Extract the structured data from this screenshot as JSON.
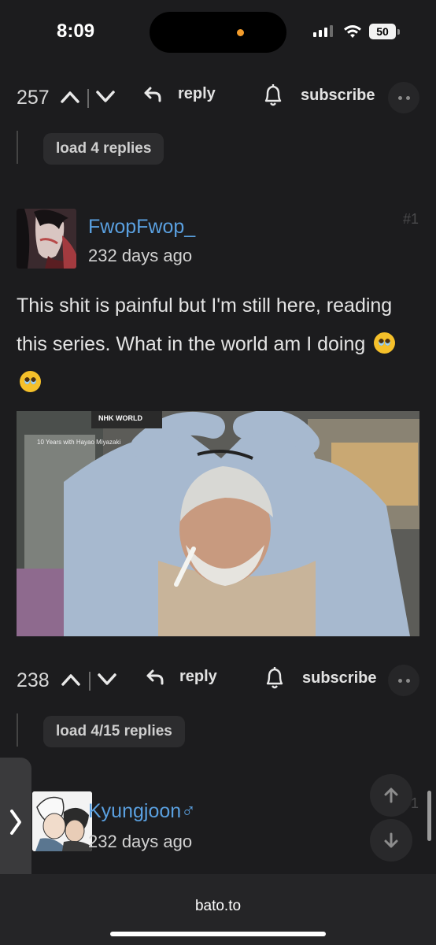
{
  "status_bar": {
    "time": "8:09",
    "battery": "50"
  },
  "comment_1_actions": {
    "votes": "257",
    "reply": "reply",
    "subscribe": "subscribe"
  },
  "replies_1": {
    "label": "load 4 replies"
  },
  "comment_2": {
    "username": "FwopFwop_",
    "ago": "232 days ago",
    "number": "#1",
    "body": "This shit is painful but I'm still here, reading this series. What in the world am I doing",
    "image_caption_brand": "NHK WORLD",
    "image_caption_show": "10 Years with Hayao Miyazaki",
    "votes": "238",
    "reply": "reply",
    "subscribe": "subscribe"
  },
  "replies_2": {
    "label": "load 4/15 replies"
  },
  "comment_3": {
    "username": "Kyungjoon♂",
    "ago": "232 days ago",
    "number": "#1"
  },
  "side_tab": {
    "icon": "chevron-right-icon"
  },
  "browser": {
    "url": "bato.to"
  }
}
